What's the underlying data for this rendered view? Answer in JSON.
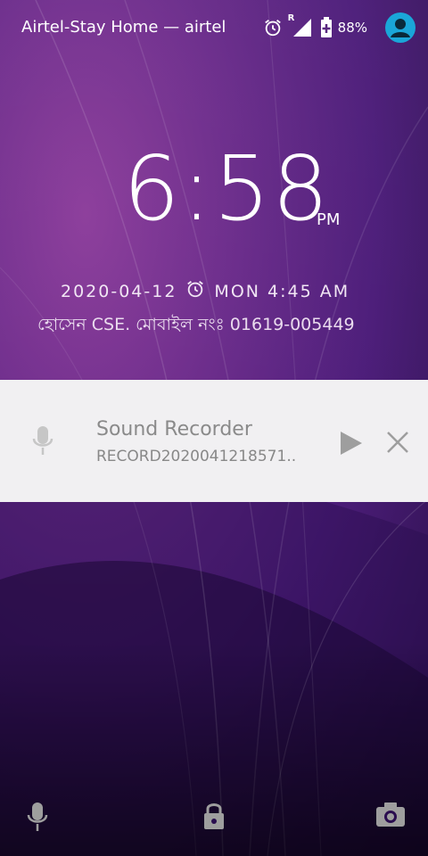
{
  "status_bar": {
    "carrier": "Airtel-Stay Home — airtel",
    "roaming_indicator": "R",
    "battery": "88%",
    "icons": [
      "alarm-icon",
      "signal-icon",
      "battery-charging-icon",
      "user-avatar-icon"
    ]
  },
  "lockscreen": {
    "time": "6:58",
    "ampm": "PM",
    "date": "2020-04-12",
    "alarm": "MON 4:45 AM",
    "owner_info": "হোসেন  CSE. মোবাইল নংঃ 01619-005449"
  },
  "notification": {
    "app_icon": "mic-icon",
    "title": "Sound Recorder",
    "subtitle": "RECORD2020041218571..",
    "actions": [
      "play-icon",
      "close-icon"
    ]
  },
  "bottom_bar": {
    "icons": [
      "voice-assist-icon",
      "lock-icon",
      "camera-icon"
    ]
  },
  "colors": {
    "accent": "#1aa6d8",
    "notification_bg": "#f1f0f2",
    "icon_gray": "#9e9e9e"
  }
}
